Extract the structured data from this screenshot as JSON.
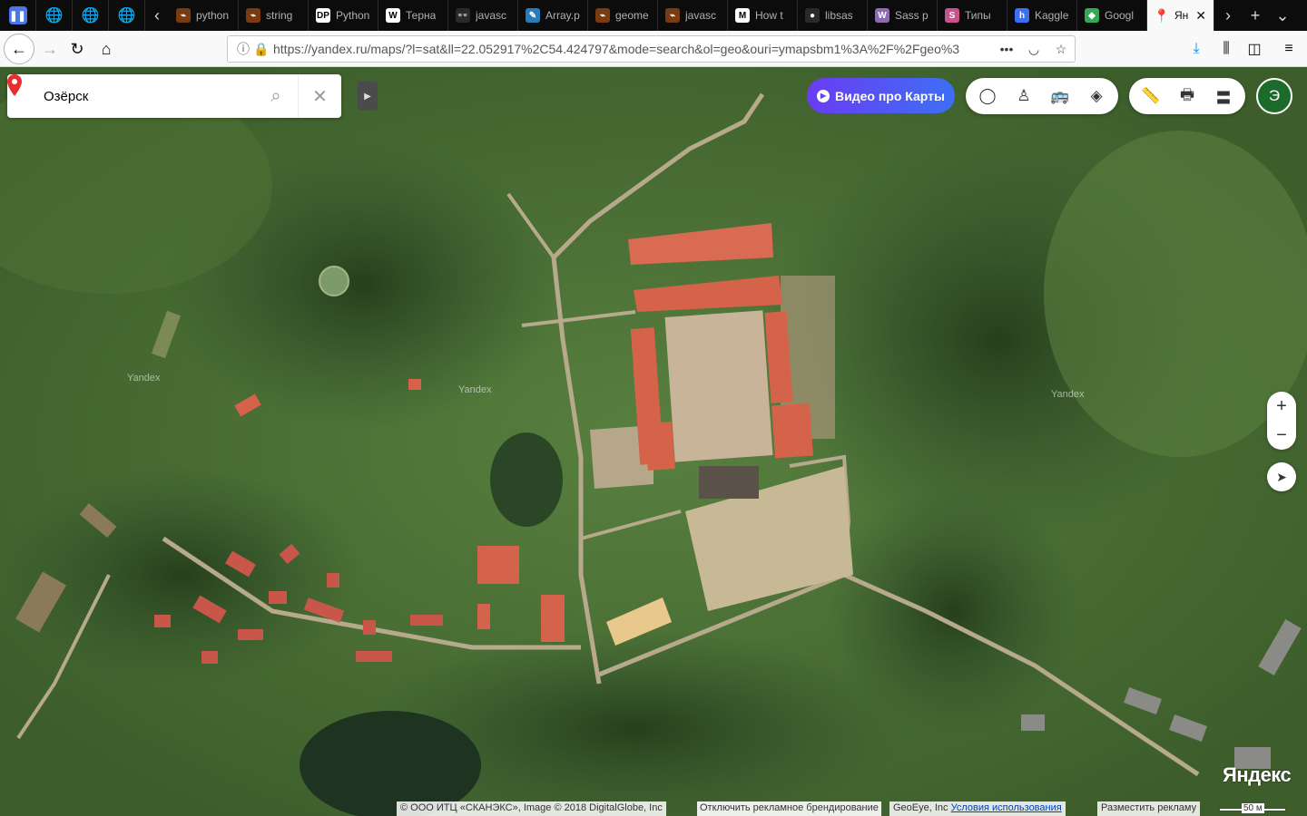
{
  "browser": {
    "tabs": [
      {
        "title": "python",
        "fav_color": "#7a3a12",
        "fav_char": "⌁"
      },
      {
        "title": "string",
        "fav_color": "#7a3a12",
        "fav_char": "⌁"
      },
      {
        "title": "Python",
        "fav_color": "#ffffff",
        "fav_char": "DP"
      },
      {
        "title": "Терна",
        "fav_color": "#ffffff",
        "fav_char": "W"
      },
      {
        "title": "javasc",
        "fav_color": "#2a2a2e",
        "fav_char": "👓"
      },
      {
        "title": "Array.p",
        "fav_color": "#2b7bb9",
        "fav_char": "✎"
      },
      {
        "title": "geome",
        "fav_color": "#7a3a12",
        "fav_char": "⌁"
      },
      {
        "title": "javasc",
        "fav_color": "#7a3a12",
        "fav_char": "⌁"
      },
      {
        "title": "How t",
        "fav_color": "#ffffff",
        "fav_char": "M"
      },
      {
        "title": "libsas",
        "fav_color": "#2a2a2e",
        "fav_char": "●"
      },
      {
        "title": "Sass p",
        "fav_color": "#8c6bb1",
        "fav_char": "W"
      },
      {
        "title": "Типы",
        "fav_color": "#c6538c",
        "fav_char": "S"
      },
      {
        "title": "Kaggle",
        "fav_color": "#3d6ff5",
        "fav_char": "h"
      },
      {
        "title": "Googl",
        "fav_color": "#34a853",
        "fav_char": "◆"
      }
    ],
    "active_tab": {
      "title": "Ян"
    },
    "url": "https://yandex.ru/maps/?l=sat&ll=22.052917%2C54.424797&mode=search&ol=geo&ouri=ymapsbm1%3A%2F%2Fgeo%3"
  },
  "map": {
    "search_value": "Озёрск",
    "video_button": "Видео про Карты",
    "avatar_letter": "Э",
    "watermarks": [
      "Yandex",
      "Yandex",
      "Yandex"
    ],
    "logo": "Яндекс",
    "copyright_text": "© ООО ИТЦ «СКАНЭКС», Image © 2018 DigitalGlobe, Inc",
    "geoeye_text": "GeoEye, Inc",
    "terms_link": "Условия использования",
    "disable_branding": "Отключить рекламное брендирование",
    "advertise": "Разместить рекламу",
    "scale_label": "50 м"
  }
}
